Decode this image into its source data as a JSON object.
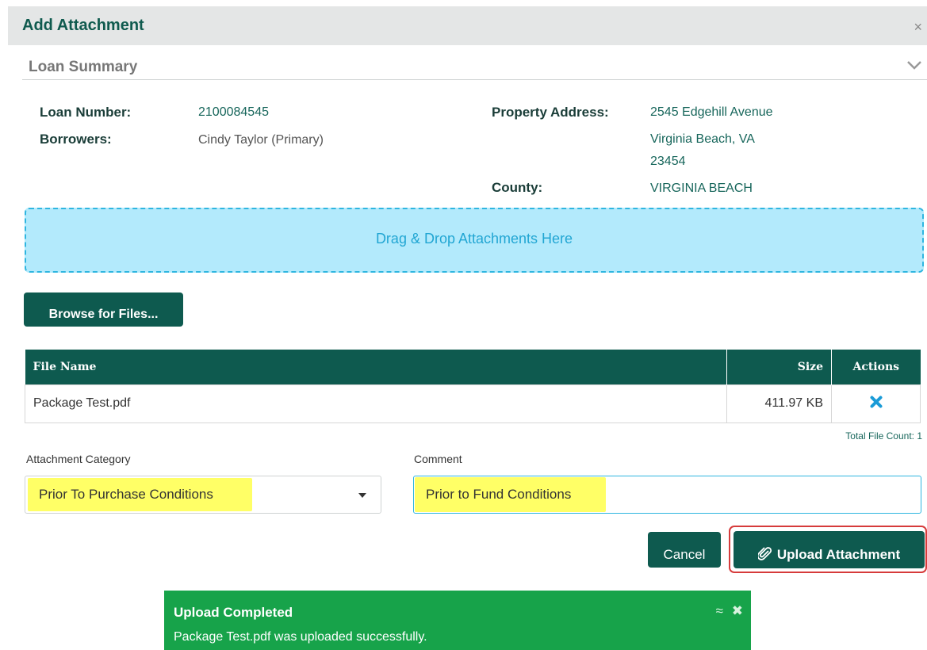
{
  "dialog": {
    "title": "Add Attachment",
    "close_glyph": "×"
  },
  "loan_summary": {
    "heading": "Loan Summary",
    "loan_number_label": "Loan Number:",
    "loan_number": "2100084545",
    "borrowers_label": "Borrowers:",
    "borrowers": "Cindy Taylor (Primary)",
    "property_address_label": "Property Address:",
    "address_line1": "2545 Edgehill Avenue",
    "address_line2": "Virginia Beach, VA",
    "address_line3": "23454",
    "county_label": "County:",
    "county": "VIRGINIA BEACH"
  },
  "dropzone": {
    "text": "Drag & Drop Attachments Here"
  },
  "browse_button": {
    "label": "Browse for Files..."
  },
  "files_table": {
    "headers": {
      "file_name": "File Name",
      "size": "Size",
      "actions": "Actions"
    },
    "rows": [
      {
        "file_name": "Package Test.pdf",
        "size": "411.97 KB",
        "action_icon": "remove-icon"
      }
    ],
    "total_label": "Total File Count: 1"
  },
  "form": {
    "category_label": "Attachment Category",
    "category_value": "Prior To Purchase Conditions",
    "comment_label": "Comment",
    "comment_value": "Prior to Fund Conditions"
  },
  "buttons": {
    "cancel": "Cancel",
    "upload": "Upload Attachment"
  },
  "toast": {
    "title": "Upload Completed",
    "message": "Package Test.pdf was uploaded successfully.",
    "collapse_glyph": "≈",
    "close_glyph": "✖"
  },
  "colors": {
    "brand": "#0e5a4f",
    "dropzone": "#b3eafc",
    "toast": "#17a34a",
    "highlight": "#ffff66",
    "outline": "#d63b3b"
  }
}
